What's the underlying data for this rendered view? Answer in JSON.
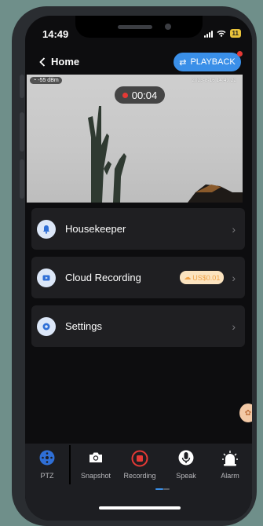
{
  "status_bar": {
    "time": "14:49",
    "battery": "11"
  },
  "nav": {
    "back_label": "Home",
    "playback_label": "PLAYBACK"
  },
  "video": {
    "signal": "-55 dBm",
    "timestamp": "2023-8-16 14:49:22",
    "recording_time": "00:04"
  },
  "menu": [
    {
      "label": "Housekeeper"
    },
    {
      "label": "Cloud Recording",
      "badge": "US$0.01"
    },
    {
      "label": "Settings"
    }
  ],
  "tabs": [
    {
      "label": "PTZ"
    },
    {
      "label": "Snapshot"
    },
    {
      "label": "Recording"
    },
    {
      "label": "Speak"
    },
    {
      "label": "Alarm"
    }
  ],
  "colors": {
    "accent": "#3a8fe8",
    "record": "#e53935",
    "tab_icon_active": "#2f6fd6"
  }
}
